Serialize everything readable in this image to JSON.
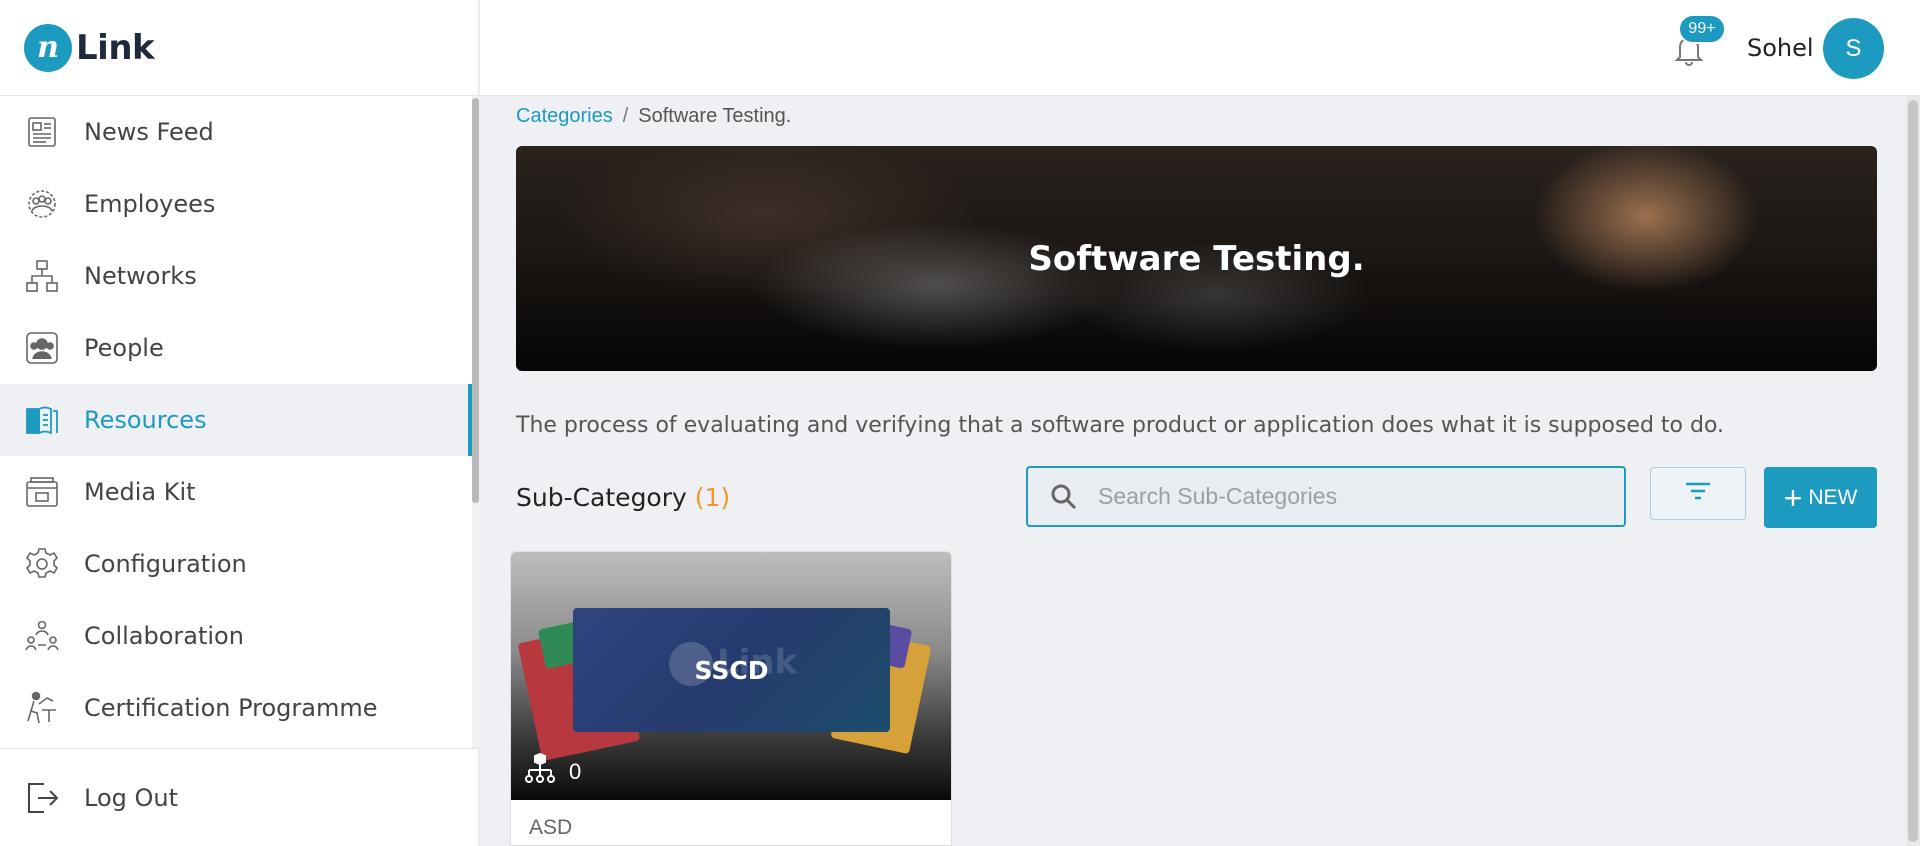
{
  "app": {
    "logo_mark": "n",
    "logo_text": "Link"
  },
  "sidebar": {
    "items": [
      {
        "label": "News Feed",
        "icon": "newspaper-icon",
        "active": false
      },
      {
        "label": "Employees",
        "icon": "employees-icon",
        "active": false
      },
      {
        "label": "Networks",
        "icon": "network-icon",
        "active": false
      },
      {
        "label": "People",
        "icon": "people-icon",
        "active": false
      },
      {
        "label": "Resources",
        "icon": "book-icon",
        "active": true
      },
      {
        "label": "Media Kit",
        "icon": "media-kit-icon",
        "active": false
      },
      {
        "label": "Configuration",
        "icon": "gear-icon",
        "active": false
      },
      {
        "label": "Collaboration",
        "icon": "collaboration-icon",
        "active": false
      },
      {
        "label": "Certification Programme",
        "icon": "certification-icon",
        "active": false
      }
    ],
    "logout_label": "Log Out"
  },
  "header": {
    "notification_badge": "99+",
    "username": "Sohel",
    "avatar_initial": "S"
  },
  "breadcrumb": {
    "parent": "Categories",
    "separator": "/",
    "current": "Software Testing."
  },
  "banner": {
    "title": "Software Testing."
  },
  "description": "The process of evaluating and verifying that a software product or application does what it is supposed to do.",
  "subcategory": {
    "title": "Sub-Category",
    "count": "(1)",
    "search_placeholder": "Search Sub-Categories",
    "new_button_label": "NEW"
  },
  "cards": [
    {
      "name": "SSCD",
      "members": "0",
      "footer": "ASD",
      "watermark": "Link"
    }
  ],
  "colors": {
    "accent": "#1d9ac0",
    "count_orange": "#f0962a"
  }
}
